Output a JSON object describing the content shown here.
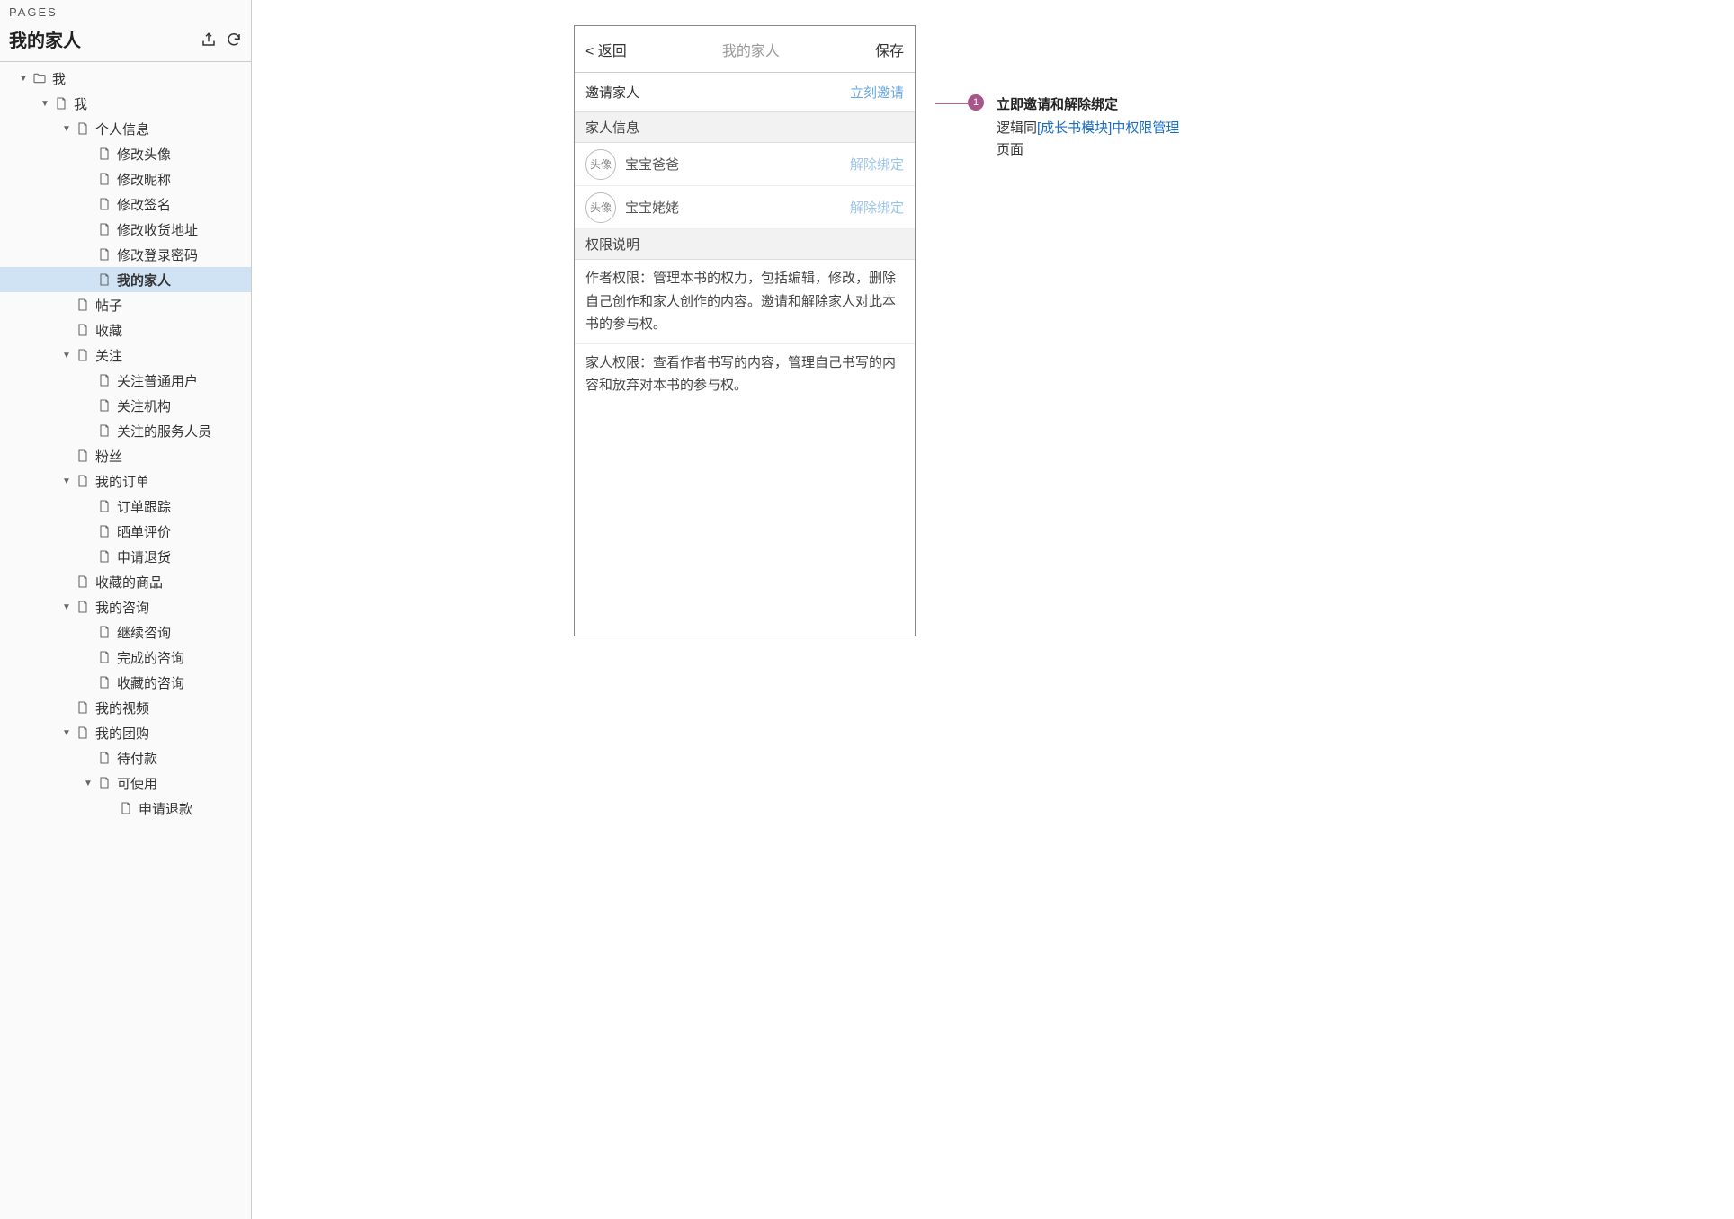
{
  "sidebar": {
    "panel_label": "PAGES",
    "title": "我的家人",
    "tree": [
      {
        "label": "我",
        "indent": 0,
        "caret": true,
        "icon": "folder",
        "selected": false
      },
      {
        "label": "我",
        "indent": 1,
        "caret": true,
        "icon": "page",
        "selected": false
      },
      {
        "label": "个人信息",
        "indent": 2,
        "caret": true,
        "icon": "page",
        "selected": false
      },
      {
        "label": "修改头像",
        "indent": 3,
        "caret": false,
        "icon": "page",
        "selected": false
      },
      {
        "label": "修改昵称",
        "indent": 3,
        "caret": false,
        "icon": "page",
        "selected": false
      },
      {
        "label": "修改签名",
        "indent": 3,
        "caret": false,
        "icon": "page",
        "selected": false
      },
      {
        "label": "修改收货地址",
        "indent": 3,
        "caret": false,
        "icon": "page",
        "selected": false
      },
      {
        "label": "修改登录密码",
        "indent": 3,
        "caret": false,
        "icon": "page",
        "selected": false
      },
      {
        "label": "我的家人",
        "indent": 3,
        "caret": false,
        "icon": "page",
        "selected": true
      },
      {
        "label": "帖子",
        "indent": 2,
        "caret": false,
        "icon": "page",
        "selected": false
      },
      {
        "label": "收藏",
        "indent": 2,
        "caret": false,
        "icon": "page",
        "selected": false
      },
      {
        "label": "关注",
        "indent": 2,
        "caret": true,
        "icon": "page",
        "selected": false
      },
      {
        "label": "关注普通用户",
        "indent": 3,
        "caret": false,
        "icon": "page",
        "selected": false
      },
      {
        "label": "关注机构",
        "indent": 3,
        "caret": false,
        "icon": "page",
        "selected": false
      },
      {
        "label": "关注的服务人员",
        "indent": 3,
        "caret": false,
        "icon": "page",
        "selected": false
      },
      {
        "label": "粉丝",
        "indent": 2,
        "caret": false,
        "icon": "page",
        "selected": false
      },
      {
        "label": "我的订单",
        "indent": 2,
        "caret": true,
        "icon": "page",
        "selected": false
      },
      {
        "label": "订单跟踪",
        "indent": 3,
        "caret": false,
        "icon": "page",
        "selected": false
      },
      {
        "label": "晒单评价",
        "indent": 3,
        "caret": false,
        "icon": "page",
        "selected": false
      },
      {
        "label": "申请退货",
        "indent": 3,
        "caret": false,
        "icon": "page",
        "selected": false
      },
      {
        "label": "收藏的商品",
        "indent": 2,
        "caret": false,
        "icon": "page",
        "selected": false
      },
      {
        "label": "我的咨询",
        "indent": 2,
        "caret": true,
        "icon": "page",
        "selected": false
      },
      {
        "label": "继续咨询",
        "indent": 3,
        "caret": false,
        "icon": "page",
        "selected": false
      },
      {
        "label": "完成的咨询",
        "indent": 3,
        "caret": false,
        "icon": "page",
        "selected": false
      },
      {
        "label": "收藏的咨询",
        "indent": 3,
        "caret": false,
        "icon": "page",
        "selected": false
      },
      {
        "label": "我的视频",
        "indent": 2,
        "caret": false,
        "icon": "page",
        "selected": false
      },
      {
        "label": "我的团购",
        "indent": 2,
        "caret": true,
        "icon": "page",
        "selected": false
      },
      {
        "label": "待付款",
        "indent": 3,
        "caret": false,
        "icon": "page",
        "selected": false
      },
      {
        "label": "可使用",
        "indent": 3,
        "caret": true,
        "icon": "page",
        "selected": false
      },
      {
        "label": "申请退款",
        "indent": 4,
        "caret": false,
        "icon": "page",
        "selected": false
      }
    ]
  },
  "mock": {
    "nav": {
      "back": "< 返回",
      "title": "我的家人",
      "save": "保存"
    },
    "invite": {
      "label": "邀请家人",
      "action": "立刻邀请"
    },
    "family_header": "家人信息",
    "avatar_placeholder": "头像",
    "family": [
      {
        "name": "宝宝爸爸",
        "action": "解除绑定"
      },
      {
        "name": "宝宝姥姥",
        "action": "解除绑定"
      }
    ],
    "perm_header": "权限说明",
    "perm_author": "作者权限：管理本书的权力，包括编辑，修改，删除自己创作和家人创作的内容。邀请和解除家人对此本书的参与权。",
    "perm_family": "家人权限：查看作者书写的内容，管理自己书写的内容和放弃对本书的参与权。"
  },
  "annotation": {
    "badge": "1",
    "title": "立即邀请和解除绑定",
    "body_prefix": "逻辑同",
    "body_link": "[成长书模块]中权限管理",
    "body_suffix": "页面"
  }
}
